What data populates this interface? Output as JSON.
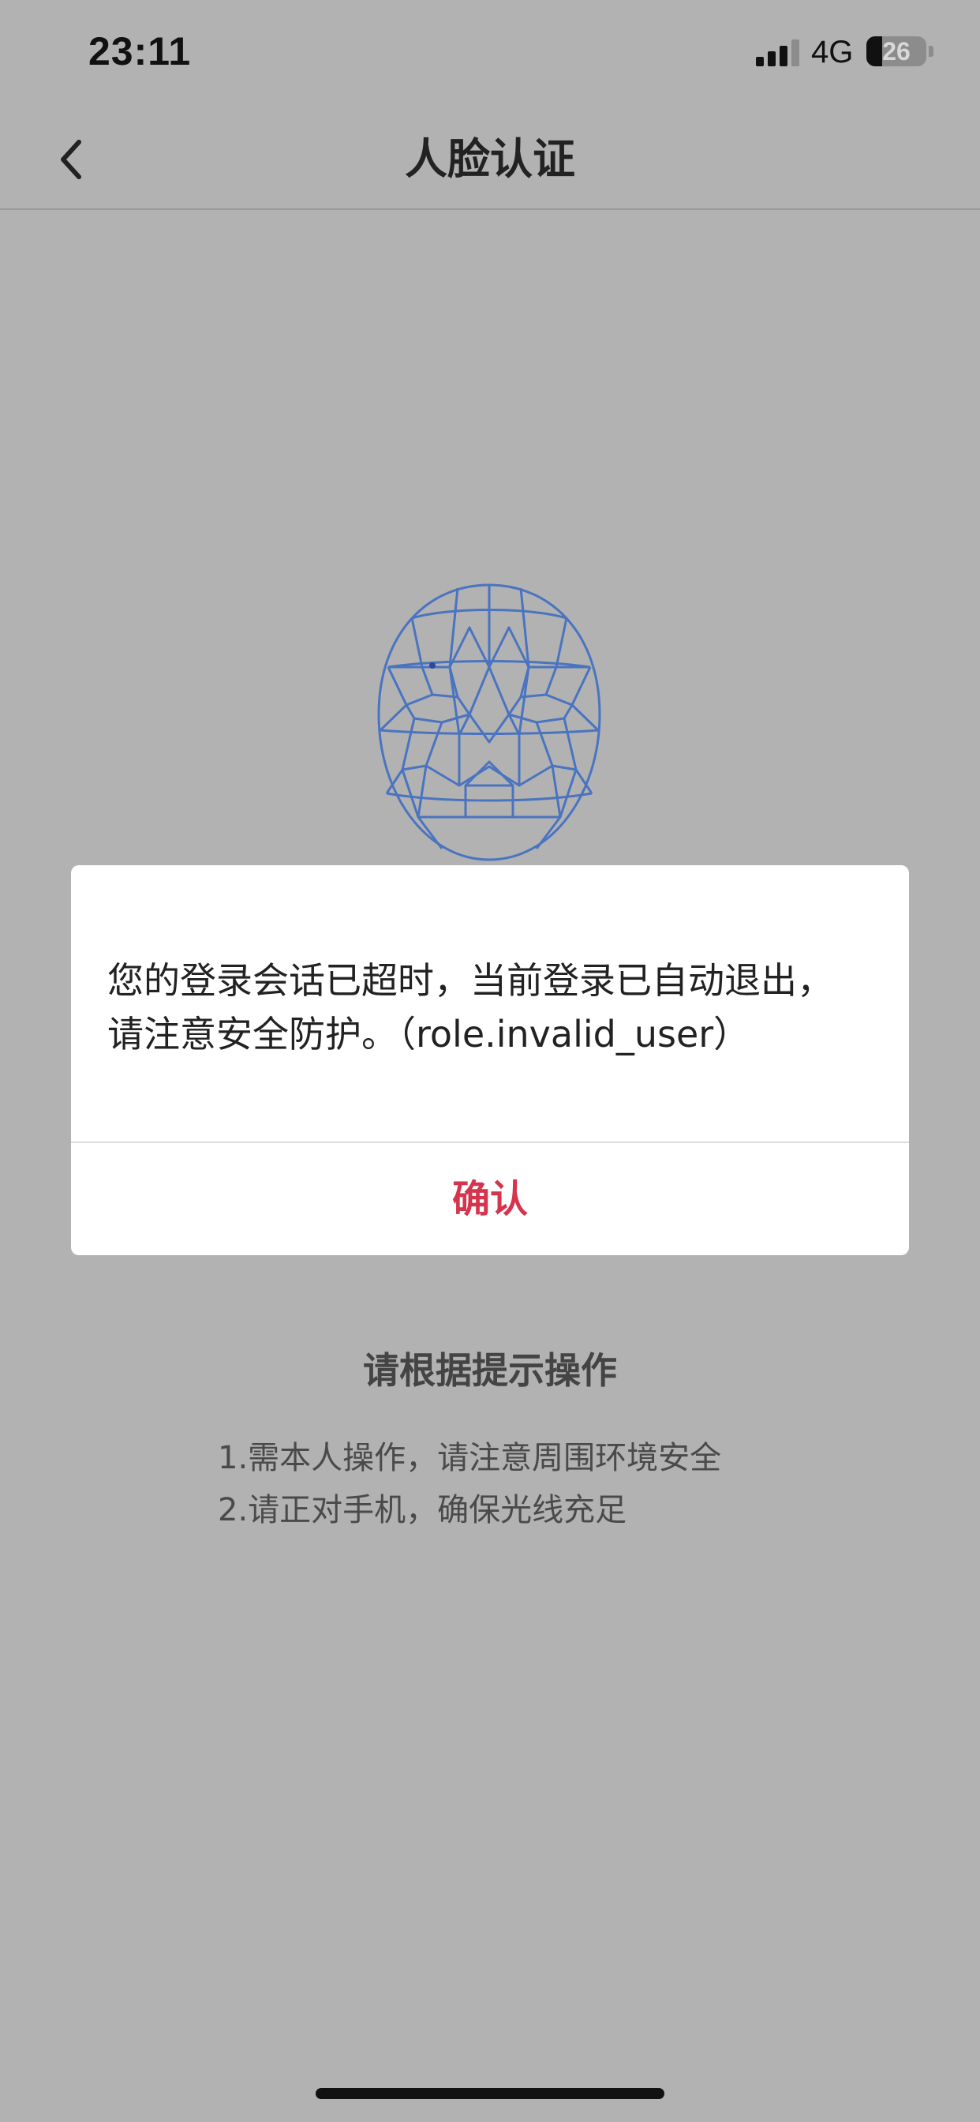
{
  "status_bar": {
    "time": "23:11",
    "network": "4G",
    "battery_level": "26",
    "battery_percent": 26
  },
  "nav": {
    "title": "人脸认证",
    "back_icon": "chevron-left-icon"
  },
  "face_icon": "face-mesh-icon",
  "instructions": {
    "title": "请根据提示操作",
    "lines": [
      "1.需本人操作，请注意周围环境安全",
      "2.请正对手机，确保光线充足"
    ]
  },
  "dialog": {
    "message_line1": "您的登录会话已超时，当前登录已自动退出，",
    "message_line2": "请注意安全防护。（role.invalid_user）",
    "confirm_label": "确认"
  },
  "colors": {
    "background": "#b2b2b2",
    "face_mesh": "#4a74c0",
    "confirm": "#d6344d",
    "modal": "#ffffff"
  }
}
